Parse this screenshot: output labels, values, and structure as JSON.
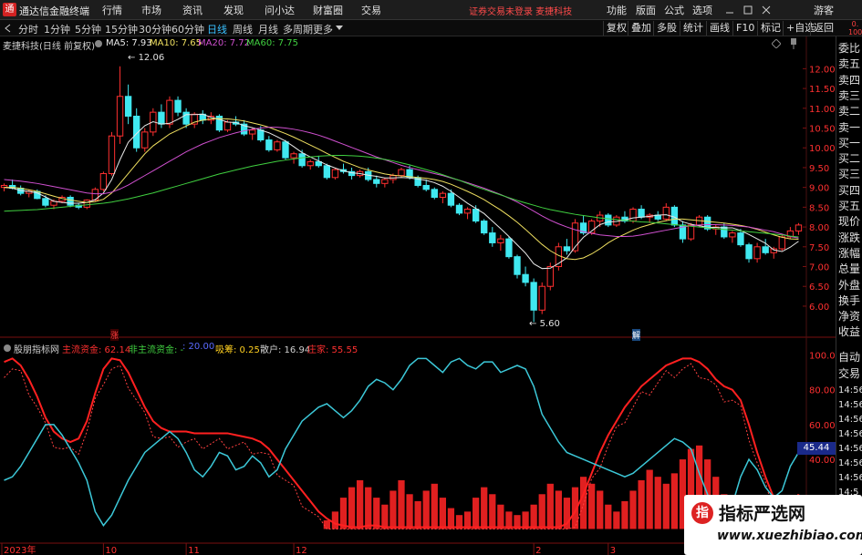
{
  "app": {
    "title": "通达信金融终端",
    "logo_text": "通",
    "notice": "证券交易未登录  麦捷科技"
  },
  "menu": [
    "行情",
    "市场",
    "资讯",
    "发现",
    "问小达",
    "财富圈",
    "交易",
    "功能",
    "版面",
    "公式",
    "选项",
    "游客"
  ],
  "toolbar": {
    "periods": [
      "分时",
      "1分钟",
      "5分钟",
      "15分钟",
      "30分钟",
      "60分钟",
      "日线",
      "周线",
      "月线",
      "多周期",
      "更多"
    ],
    "active_period": "日线",
    "right_buttons": [
      "复权",
      "叠加",
      "多股",
      "统计",
      "画线",
      "F10",
      "标记",
      "+自选",
      "返回"
    ]
  },
  "chart_header": {
    "stock": "麦捷科技(日线 前复权)",
    "ma5": "MA5: 7.93",
    "ma10": "MA10: 7.65",
    "ma20": "MA20: 7.72",
    "ma60": "MA60: 7.75",
    "colors": {
      "ma5": "#e8e8e8",
      "ma10": "#f0e060",
      "ma20": "#d050d0",
      "ma60": "#40d040"
    }
  },
  "annotations": {
    "high": "12.06",
    "low": "5.60",
    "zhang": "涨",
    "jie": "解"
  },
  "price_axis": [
    "12.00",
    "11.50",
    "11.00",
    "10.50",
    "10.00",
    "9.50",
    "9.00",
    "8.50",
    "8.00",
    "7.50",
    "7.00",
    "6.50",
    "6.00"
  ],
  "indicator": {
    "name": "股朋指标网",
    "main_fund": "主流资金: 62.14",
    "non_main": "非主流资金: -",
    "val20": ": 20.00",
    "chip": "吸筹: 0.25",
    "retail": "散户: 16.94",
    "dealer": "庄家: 55.55",
    "axis": [
      "100.0",
      "80.00",
      "60.00",
      "40.00"
    ],
    "current": "45.44",
    "colors": {
      "main": "#ff3030",
      "retail": "#3cc8d8",
      "dealer": "#ff3030"
    }
  },
  "date_axis": [
    "2023年",
    "10",
    "11",
    "12",
    "2",
    "3"
  ],
  "sidebar": {
    "top": "0.\n1000",
    "items": [
      "委比",
      "卖五",
      "卖四",
      "卖三",
      "卖二",
      "卖一",
      "买一",
      "买二",
      "买三",
      "买四",
      "买五",
      "现价",
      "涨跌",
      "涨幅",
      "总量",
      "外盘",
      "换手",
      "净资",
      "收益",
      "自动",
      "交易"
    ],
    "times": [
      "14:56",
      "14:56",
      "14:56",
      "14:56",
      "14:56",
      "14:56",
      "14:56",
      "14:5"
    ]
  },
  "watermark": {
    "title": "指标严选网",
    "url": "www.xuezhibiao.com",
    "logo": "指"
  },
  "chart_data": {
    "type": "candlestick",
    "title": "麦捷科技(日线 前复权)",
    "ylim": [
      5.4,
      12.4
    ],
    "candles": [
      [
        9.0,
        9.1,
        8.9,
        9.05
      ],
      [
        9.05,
        9.2,
        8.95,
        8.98
      ],
      [
        8.98,
        9.05,
        8.8,
        8.85
      ],
      [
        8.85,
        8.95,
        8.75,
        8.9
      ],
      [
        8.9,
        8.95,
        8.7,
        8.72
      ],
      [
        8.72,
        8.8,
        8.5,
        8.55
      ],
      [
        8.55,
        8.7,
        8.45,
        8.65
      ],
      [
        8.65,
        8.8,
        8.6,
        8.75
      ],
      [
        8.75,
        8.8,
        8.5,
        8.55
      ],
      [
        8.55,
        8.6,
        8.45,
        8.5
      ],
      [
        8.5,
        8.7,
        8.45,
        8.68
      ],
      [
        8.68,
        9.0,
        8.65,
        8.95
      ],
      [
        8.95,
        9.4,
        8.9,
        9.35
      ],
      [
        9.35,
        10.4,
        9.3,
        10.3
      ],
      [
        10.3,
        12.06,
        10.1,
        11.3
      ],
      [
        11.3,
        11.6,
        10.6,
        10.8
      ],
      [
        10.8,
        11.0,
        9.9,
        10.0
      ],
      [
        10.0,
        10.5,
        9.9,
        10.4
      ],
      [
        10.4,
        11.0,
        10.3,
        10.9
      ],
      [
        10.9,
        11.1,
        10.5,
        10.6
      ],
      [
        10.6,
        11.3,
        10.5,
        11.2
      ],
      [
        11.2,
        11.3,
        10.8,
        10.9
      ],
      [
        10.9,
        11.0,
        10.5,
        10.6
      ],
      [
        10.6,
        10.9,
        10.5,
        10.85
      ],
      [
        10.85,
        10.95,
        10.6,
        10.7
      ],
      [
        10.7,
        10.9,
        10.6,
        10.8
      ],
      [
        10.8,
        10.85,
        10.4,
        10.45
      ],
      [
        10.45,
        10.7,
        10.4,
        10.65
      ],
      [
        10.65,
        10.8,
        10.55,
        10.6
      ],
      [
        10.6,
        10.7,
        10.3,
        10.35
      ],
      [
        10.35,
        10.5,
        10.2,
        10.45
      ],
      [
        10.45,
        10.55,
        10.15,
        10.2
      ],
      [
        10.2,
        10.3,
        9.9,
        9.95
      ],
      [
        9.95,
        10.2,
        9.9,
        10.15
      ],
      [
        10.15,
        10.2,
        9.7,
        9.75
      ],
      [
        9.75,
        9.9,
        9.6,
        9.85
      ],
      [
        9.85,
        9.95,
        9.5,
        9.55
      ],
      [
        9.55,
        9.7,
        9.45,
        9.65
      ],
      [
        9.65,
        9.8,
        9.5,
        9.55
      ],
      [
        9.55,
        9.6,
        9.2,
        9.25
      ],
      [
        9.25,
        9.5,
        9.2,
        9.45
      ],
      [
        9.45,
        9.6,
        9.35,
        9.4
      ],
      [
        9.4,
        9.5,
        9.2,
        9.3
      ],
      [
        9.3,
        9.45,
        9.25,
        9.4
      ],
      [
        9.4,
        9.5,
        9.15,
        9.2
      ],
      [
        9.2,
        9.3,
        9.0,
        9.1
      ],
      [
        9.1,
        9.25,
        9.0,
        9.2
      ],
      [
        9.2,
        9.35,
        9.1,
        9.3
      ],
      [
        9.3,
        9.5,
        9.25,
        9.45
      ],
      [
        9.45,
        9.55,
        9.2,
        9.25
      ],
      [
        9.25,
        9.3,
        9.0,
        9.05
      ],
      [
        9.05,
        9.2,
        8.9,
        8.95
      ],
      [
        8.95,
        9.0,
        8.7,
        8.75
      ],
      [
        8.75,
        8.9,
        8.6,
        8.85
      ],
      [
        8.85,
        8.95,
        8.5,
        8.55
      ],
      [
        8.55,
        8.6,
        8.3,
        8.35
      ],
      [
        8.35,
        8.5,
        8.2,
        8.45
      ],
      [
        8.45,
        8.55,
        8.1,
        8.15
      ],
      [
        8.15,
        8.2,
        7.8,
        7.85
      ],
      [
        7.85,
        8.0,
        7.5,
        7.6
      ],
      [
        7.6,
        7.8,
        7.4,
        7.7
      ],
      [
        7.7,
        7.75,
        7.2,
        7.25
      ],
      [
        7.25,
        7.3,
        6.7,
        6.8
      ],
      [
        6.8,
        7.0,
        6.5,
        6.6
      ],
      [
        6.6,
        6.7,
        5.6,
        5.9
      ],
      [
        5.9,
        6.6,
        5.8,
        6.5
      ],
      [
        6.5,
        7.1,
        6.4,
        7.0
      ],
      [
        7.0,
        7.6,
        6.9,
        7.5
      ],
      [
        7.5,
        7.7,
        7.3,
        7.4
      ],
      [
        7.4,
        8.2,
        7.35,
        8.1
      ],
      [
        8.1,
        8.3,
        7.8,
        7.85
      ],
      [
        7.85,
        8.2,
        7.8,
        8.15
      ],
      [
        8.15,
        8.4,
        8.0,
        8.3
      ],
      [
        8.3,
        8.35,
        8.0,
        8.05
      ],
      [
        8.05,
        8.3,
        8.0,
        8.25
      ],
      [
        8.25,
        8.4,
        8.1,
        8.15
      ],
      [
        8.15,
        8.5,
        8.1,
        8.45
      ],
      [
        8.45,
        8.55,
        8.2,
        8.25
      ],
      [
        8.25,
        8.35,
        8.1,
        8.3
      ],
      [
        8.3,
        8.4,
        8.15,
        8.2
      ],
      [
        8.2,
        8.6,
        8.15,
        8.5
      ],
      [
        8.5,
        8.55,
        8.0,
        8.05
      ],
      [
        8.05,
        8.15,
        7.6,
        7.7
      ],
      [
        7.7,
        8.1,
        7.65,
        8.05
      ],
      [
        8.05,
        8.3,
        8.0,
        8.25
      ],
      [
        8.25,
        8.3,
        7.9,
        7.95
      ],
      [
        7.95,
        8.05,
        7.8,
        8.0
      ],
      [
        8.0,
        8.1,
        7.7,
        7.75
      ],
      [
        7.75,
        7.9,
        7.6,
        7.85
      ],
      [
        7.85,
        7.95,
        7.5,
        7.55
      ],
      [
        7.55,
        7.6,
        7.1,
        7.2
      ],
      [
        7.2,
        7.6,
        7.1,
        7.5
      ],
      [
        7.5,
        7.7,
        7.3,
        7.35
      ],
      [
        7.35,
        7.5,
        7.2,
        7.45
      ],
      [
        7.45,
        7.8,
        7.4,
        7.75
      ],
      [
        7.75,
        8.0,
        7.7,
        7.9
      ],
      [
        7.9,
        8.1,
        7.8,
        8.05
      ]
    ],
    "ma_series": [
      {
        "name": "MA5",
        "values": [
          9.0,
          8.98,
          8.92,
          8.9,
          8.86,
          8.76,
          8.65,
          8.62,
          8.6,
          8.6,
          8.62,
          8.69,
          8.86,
          9.2,
          9.7,
          10.14,
          10.36,
          10.56,
          10.66,
          10.6,
          10.62,
          10.72,
          10.84,
          10.84,
          10.85,
          10.77,
          10.72,
          10.65,
          10.64,
          10.56,
          10.51,
          10.45,
          10.38,
          10.28,
          10.17,
          10.03,
          9.88,
          9.77,
          9.67,
          9.57,
          9.49,
          9.42,
          9.37,
          9.35,
          9.31,
          9.28,
          9.24,
          9.24,
          9.25,
          9.24,
          9.21,
          9.18,
          9.12,
          9.03,
          8.9,
          8.75,
          8.6,
          8.47,
          8.34,
          8.15,
          7.96,
          7.76,
          7.55,
          7.34,
          7.07,
          6.95,
          6.96,
          7.08,
          7.22,
          7.5,
          7.74,
          7.9,
          8.06,
          8.13,
          8.14,
          8.18,
          8.23,
          8.25,
          8.27,
          8.3,
          8.31,
          8.25,
          8.13,
          8.07,
          8.03,
          7.99,
          7.99,
          7.98,
          7.98,
          7.91,
          7.81,
          7.7,
          7.59,
          7.42,
          7.38,
          7.49,
          7.64
        ]
      },
      {
        "name": "MA10",
        "values": [
          9.0,
          9.0,
          8.98,
          8.94,
          8.9,
          8.84,
          8.78,
          8.72,
          8.68,
          8.65,
          8.62,
          8.64,
          8.7,
          8.86,
          9.1,
          9.35,
          9.6,
          9.85,
          10.05,
          10.2,
          10.35,
          10.45,
          10.55,
          10.65,
          10.7,
          10.73,
          10.74,
          10.73,
          10.71,
          10.68,
          10.63,
          10.58,
          10.52,
          10.44,
          10.36,
          10.27,
          10.17,
          10.07,
          9.97,
          9.86,
          9.76,
          9.66,
          9.58,
          9.5,
          9.44,
          9.39,
          9.34,
          9.31,
          9.29,
          9.27,
          9.25,
          9.23,
          9.2,
          9.15,
          9.08,
          8.99,
          8.9,
          8.8,
          8.69,
          8.56,
          8.43,
          8.28,
          8.12,
          7.94,
          7.75,
          7.56,
          7.4,
          7.28,
          7.2,
          7.18,
          7.22,
          7.32,
          7.45,
          7.6,
          7.72,
          7.82,
          7.92,
          8.0,
          8.06,
          8.12,
          8.16,
          8.2,
          8.2,
          8.18,
          8.16,
          8.14,
          8.12,
          8.1,
          8.07,
          8.04,
          8.0,
          7.94,
          7.87,
          7.8,
          7.74,
          7.7,
          7.69
        ]
      },
      {
        "name": "MA20",
        "values": [
          9.2,
          9.18,
          9.16,
          9.13,
          9.1,
          9.06,
          9.02,
          8.98,
          8.94,
          8.9,
          8.86,
          8.84,
          8.84,
          8.88,
          8.96,
          9.06,
          9.18,
          9.3,
          9.42,
          9.54,
          9.66,
          9.78,
          9.9,
          10.0,
          10.1,
          10.18,
          10.26,
          10.32,
          10.38,
          10.43,
          10.47,
          10.5,
          10.52,
          10.52,
          10.5,
          10.47,
          10.43,
          10.38,
          10.32,
          10.25,
          10.17,
          10.09,
          10.01,
          9.93,
          9.85,
          9.77,
          9.7,
          9.63,
          9.56,
          9.5,
          9.45,
          9.4,
          9.35,
          9.3,
          9.24,
          9.18,
          9.12,
          9.05,
          8.98,
          8.9,
          8.82,
          8.73,
          8.63,
          8.52,
          8.4,
          8.28,
          8.17,
          8.08,
          8.0,
          7.93,
          7.88,
          7.84,
          7.8,
          7.78,
          7.76,
          7.76,
          7.77,
          7.8,
          7.84,
          7.88,
          7.92,
          7.96,
          8.0,
          8.03,
          8.05,
          8.06,
          8.06,
          8.05,
          8.04,
          8.02,
          8.0,
          7.96,
          7.92,
          7.88,
          7.82,
          7.76,
          7.72
        ]
      },
      {
        "name": "MA60",
        "values": [
          8.4,
          8.41,
          8.42,
          8.43,
          8.44,
          8.46,
          8.48,
          8.5,
          8.52,
          8.54,
          8.56,
          8.58,
          8.6,
          8.63,
          8.67,
          8.71,
          8.76,
          8.81,
          8.86,
          8.92,
          8.98,
          9.04,
          9.1,
          9.16,
          9.22,
          9.28,
          9.34,
          9.39,
          9.44,
          9.49,
          9.54,
          9.58,
          9.62,
          9.66,
          9.69,
          9.72,
          9.75,
          9.77,
          9.79,
          9.8,
          9.81,
          9.81,
          9.8,
          9.79,
          9.77,
          9.74,
          9.71,
          9.67,
          9.62,
          9.57,
          9.51,
          9.45,
          9.39,
          9.32,
          9.25,
          9.18,
          9.1,
          9.02,
          8.95,
          8.88,
          8.81,
          8.74,
          8.67,
          8.61,
          8.55,
          8.49,
          8.44,
          8.4,
          8.36,
          8.32,
          8.29,
          8.26,
          8.23,
          8.21,
          8.19,
          8.17,
          8.15,
          8.13,
          8.12,
          8.1,
          8.08,
          8.06,
          8.04,
          8.02,
          8.0,
          7.98,
          7.96,
          7.94,
          7.92,
          7.9,
          7.88,
          7.86,
          7.84,
          7.82,
          7.8,
          7.77,
          7.75
        ]
      }
    ],
    "indicator_series": [
      {
        "name": "主流资金",
        "values": [
          96,
          98,
          94,
          86,
          76,
          64,
          56,
          52,
          50,
          52,
          62,
          78,
          92,
          98,
          97,
          90,
          80,
          70,
          62,
          58,
          56,
          56,
          56,
          55,
          55,
          55,
          55,
          55,
          54,
          53,
          52,
          50,
          46,
          40,
          34,
          28,
          22,
          16,
          10,
          6,
          3,
          2,
          1,
          1,
          2,
          2,
          1,
          1,
          1,
          1,
          1,
          1,
          1,
          1,
          1,
          1,
          1,
          1,
          1,
          1,
          1,
          1,
          1,
          1,
          1,
          1,
          1,
          1,
          3,
          10,
          20,
          32,
          44,
          54,
          62,
          70,
          76,
          82,
          86,
          90,
          94,
          96,
          98,
          98,
          96,
          92,
          86,
          82,
          80,
          74,
          60,
          44,
          30,
          18,
          10,
          8,
          20
        ]
      },
      {
        "name": "散户",
        "values": [
          28,
          30,
          36,
          44,
          52,
          60,
          60,
          54,
          46,
          38,
          28,
          10,
          2,
          8,
          18,
          28,
          36,
          44,
          48,
          52,
          56,
          52,
          44,
          34,
          30,
          36,
          44,
          42,
          34,
          36,
          42,
          38,
          30,
          34,
          46,
          54,
          62,
          66,
          70,
          72,
          68,
          64,
          68,
          74,
          82,
          86,
          84,
          80,
          86,
          94,
          98,
          98,
          94,
          90,
          96,
          98,
          94,
          92,
          96,
          96,
          90,
          92,
          94,
          92,
          82,
          66,
          58,
          50,
          44,
          42,
          40,
          38,
          36,
          34,
          32,
          30,
          32,
          36,
          40,
          44,
          48,
          52,
          50,
          46,
          32,
          20,
          10,
          8,
          14,
          30,
          40,
          34,
          24,
          18,
          22,
          36,
          44
        ]
      },
      {
        "name": "庄家",
        "values": [
          0,
          0,
          0,
          0,
          0,
          0,
          0,
          0,
          0,
          0,
          0,
          0,
          0,
          0,
          0,
          0,
          0,
          0,
          0,
          0,
          0,
          0,
          0,
          0,
          0,
          0,
          0,
          0,
          0,
          0,
          0,
          0,
          0,
          0,
          0,
          0,
          0,
          0,
          0,
          5,
          10,
          18,
          24,
          28,
          24,
          18,
          14,
          22,
          28,
          20,
          16,
          22,
          26,
          18,
          12,
          8,
          10,
          18,
          24,
          20,
          14,
          10,
          8,
          10,
          14,
          20,
          26,
          22,
          18,
          24,
          30,
          26,
          22,
          14,
          10,
          16,
          22,
          28,
          34,
          30,
          26,
          32,
          40,
          46,
          48,
          40,
          30,
          20,
          10,
          4,
          2,
          1,
          0,
          0,
          0,
          0,
          0
        ]
      }
    ]
  }
}
